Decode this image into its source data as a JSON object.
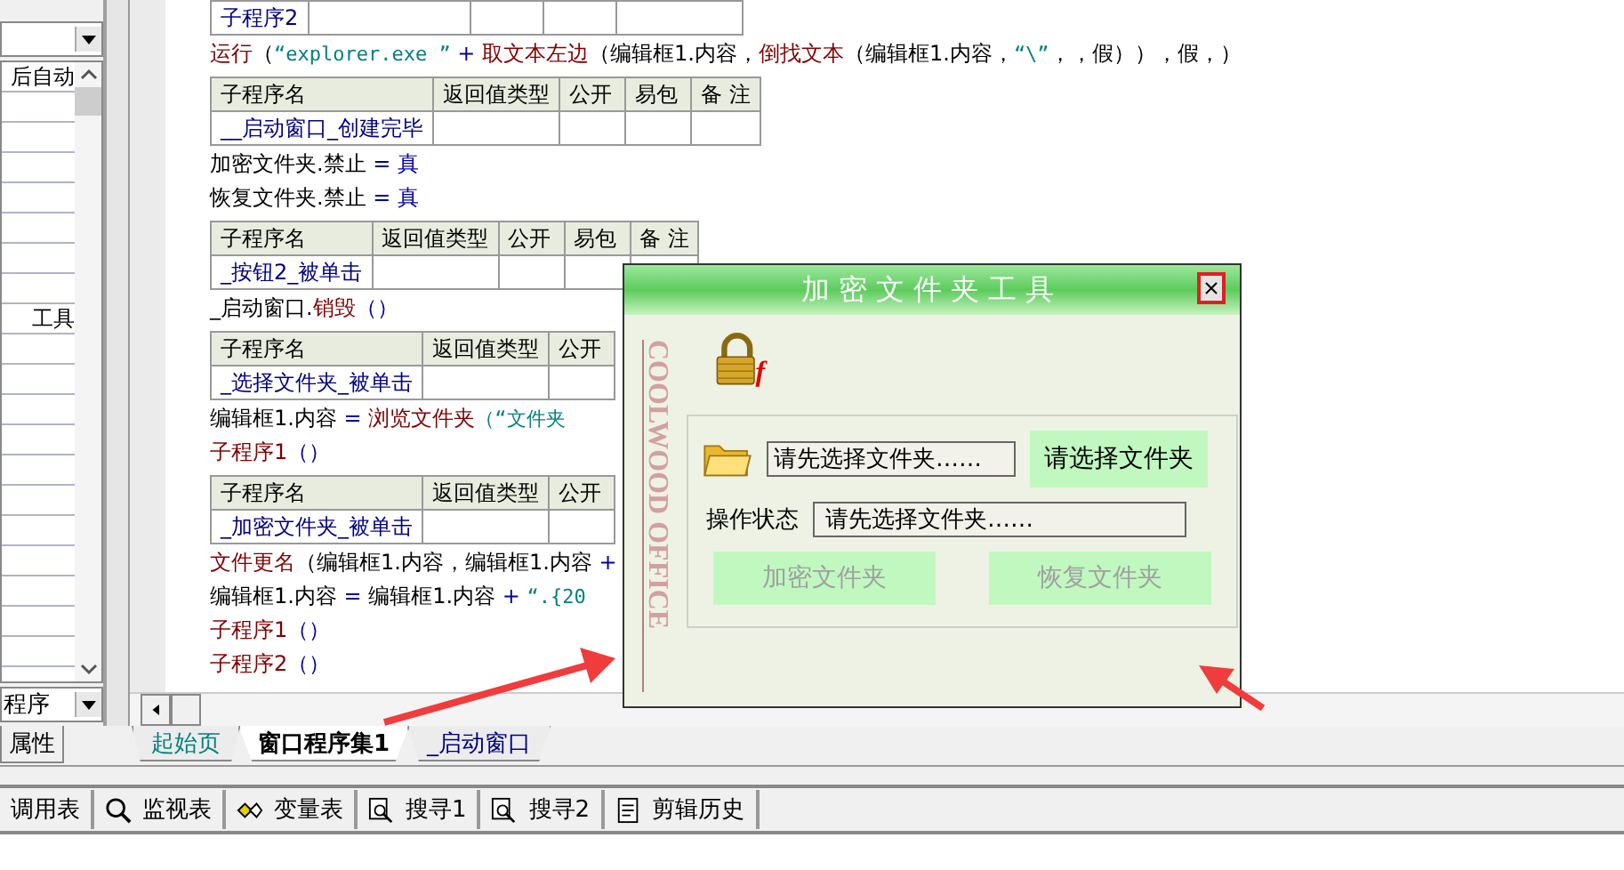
{
  "property_panel": {
    "rows": [
      {
        "text": "后自动"
      },
      {
        "text": "工具"
      }
    ],
    "bottom_combo": {
      "value": "程序"
    },
    "tabs": [
      {
        "label": "属性",
        "selected": true
      }
    ]
  },
  "code": [
    {
      "kind": "table_fragment",
      "columns": [
        "子程序2"
      ]
    },
    {
      "kind": "line",
      "segments": [
        {
          "text": "运行",
          "kind": "command"
        },
        {
          "text": "（",
          "kind": "plain"
        },
        {
          "text": "“explorer.exe ”",
          "kind": "string"
        },
        {
          "text": " + ",
          "kind": "operator"
        },
        {
          "text": "取文本左边",
          "kind": "command"
        },
        {
          "text": "（编辑框1.内容，",
          "kind": "plain"
        },
        {
          "text": "倒找文本",
          "kind": "command"
        },
        {
          "text": "（编辑框1.内容，",
          "kind": "plain"
        },
        {
          "text": "“\\”",
          "kind": "string"
        },
        {
          "text": "，，假）），假，）",
          "kind": "plain"
        }
      ]
    },
    {
      "kind": "table",
      "columns": [
        "子程序名",
        "返回值类型",
        "公开",
        "易包",
        "备 注"
      ],
      "rows": [
        {
          "name": "__启动窗口_创建完毕"
        }
      ]
    },
    {
      "kind": "line",
      "segments": [
        {
          "text": "加密文件夹.禁止",
          "kind": "plain"
        },
        {
          "text": " = 真",
          "kind": "operator"
        }
      ]
    },
    {
      "kind": "line",
      "segments": [
        {
          "text": "恢复文件夹.禁止",
          "kind": "plain"
        },
        {
          "text": " = 真",
          "kind": "operator"
        }
      ]
    },
    {
      "kind": "table",
      "columns": [
        "子程序名",
        "返回值类型",
        "公开",
        "易包",
        "备 注"
      ],
      "rows": [
        {
          "name": "_按钮2_被单击"
        }
      ]
    },
    {
      "kind": "line",
      "segments": [
        {
          "text": "_启动窗口.",
          "kind": "plain"
        },
        {
          "text": "销毁",
          "kind": "command"
        },
        {
          "text": "（）",
          "kind": "operator"
        }
      ]
    },
    {
      "kind": "table",
      "columns": [
        "子程序名",
        "返回值类型",
        "公开"
      ],
      "rows": [
        {
          "name": "_选择文件夹_被单击"
        }
      ]
    },
    {
      "kind": "line",
      "segments": [
        {
          "text": "编辑框1.内容",
          "kind": "plain"
        },
        {
          "text": " = ",
          "kind": "operator"
        },
        {
          "text": "浏览文件夹",
          "kind": "command"
        },
        {
          "text": "（“文件夹",
          "kind": "string"
        }
      ]
    },
    {
      "kind": "line",
      "segments": [
        {
          "text": "子程序1",
          "kind": "command"
        },
        {
          "text": "（）",
          "kind": "operator"
        }
      ]
    },
    {
      "kind": "table",
      "columns": [
        "子程序名",
        "返回值类型",
        "公开"
      ],
      "rows": [
        {
          "name": "_加密文件夹_被单击"
        }
      ]
    },
    {
      "kind": "line",
      "segments": [
        {
          "text": "文件更名",
          "kind": "command"
        },
        {
          "text": "（编辑框1.内容，编辑框1.内容",
          "kind": "plain"
        },
        {
          "text": " +",
          "kind": "operator"
        }
      ]
    },
    {
      "kind": "line",
      "segments": [
        {
          "text": "编辑框1.内容",
          "kind": "plain"
        },
        {
          "text": " = ",
          "kind": "operator"
        },
        {
          "text": "编辑框1.内容",
          "kind": "plain"
        },
        {
          "text": " + ",
          "kind": "operator"
        },
        {
          "text": "“.{20",
          "kind": "string"
        }
      ]
    },
    {
      "kind": "line",
      "segments": [
        {
          "text": "子程序1",
          "kind": "command"
        },
        {
          "text": "（）",
          "kind": "operator"
        }
      ]
    },
    {
      "kind": "line",
      "segments": [
        {
          "text": "子程序2",
          "kind": "command"
        },
        {
          "text": "（）",
          "kind": "operator"
        }
      ]
    }
  ],
  "editor_tabs": [
    {
      "label": "起始页",
      "selected": false,
      "kind": "page"
    },
    {
      "label": "窗口程序集1",
      "selected": true,
      "kind": "module"
    },
    {
      "label": "_启动窗口",
      "selected": false,
      "kind": "window"
    }
  ],
  "bottom_toolbar": [
    {
      "label": "调用表",
      "kind": "plain"
    },
    {
      "label": "监视表",
      "kind": "magnifier"
    },
    {
      "label": "变量表",
      "kind": "variables"
    },
    {
      "label": "搜寻1",
      "kind": "search"
    },
    {
      "label": "搜寻2",
      "kind": "search"
    },
    {
      "label": "剪辑历史",
      "kind": "history"
    }
  ],
  "dialog": {
    "title": "加密文件夹工具",
    "side_text": "COOLWOOD OFFICE",
    "lock_letter": "f",
    "folder_field": {
      "value": "请先选择文件夹……"
    },
    "select_button": {
      "label": "请选择文件夹",
      "disabled": false
    },
    "status_label": "操作状态",
    "status_field": {
      "value": "请先选择文件夹……"
    },
    "action_buttons": [
      {
        "label": "加密文件夹",
        "disabled": true
      },
      {
        "label": "恢复文件夹",
        "disabled": true
      }
    ]
  }
}
